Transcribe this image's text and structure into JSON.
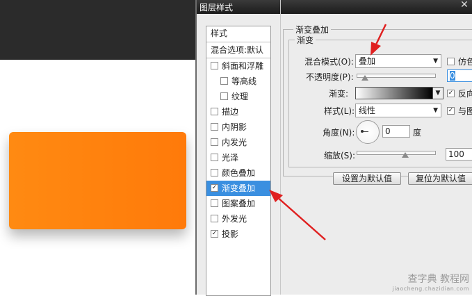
{
  "canvas": {
    "shape_color": "#ff8210"
  },
  "dialog": {
    "title": "图层样式",
    "close_icon": "close-icon",
    "style_list": {
      "header": "样式",
      "blend_options": "混合选项:默认",
      "items": [
        {
          "label": "斜面和浮雕",
          "checked": false,
          "indent": false
        },
        {
          "label": "等高线",
          "checked": false,
          "indent": true
        },
        {
          "label": "纹理",
          "checked": false,
          "indent": true
        },
        {
          "label": "描边",
          "checked": false,
          "indent": false
        },
        {
          "label": "内阴影",
          "checked": false,
          "indent": false
        },
        {
          "label": "内发光",
          "checked": false,
          "indent": false
        },
        {
          "label": "光泽",
          "checked": false,
          "indent": false
        },
        {
          "label": "颜色叠加",
          "checked": false,
          "indent": false
        },
        {
          "label": "渐变叠加",
          "checked": true,
          "indent": false,
          "selected": true
        },
        {
          "label": "图案叠加",
          "checked": false,
          "indent": false
        },
        {
          "label": "外发光",
          "checked": false,
          "indent": false
        },
        {
          "label": "投影",
          "checked": true,
          "indent": false
        }
      ]
    },
    "panel": {
      "title": "渐变叠加",
      "group": "渐变",
      "blend_mode_label": "混合模式(O):",
      "blend_mode_value": "叠加",
      "dither_label": "仿色",
      "opacity_label": "不透明度(P):",
      "opacity_value": "0",
      "gradient_label": "渐变:",
      "reverse_label": "反向",
      "style_label": "样式(L):",
      "style_value": "线性",
      "align_label": "与图",
      "angle_label": "角度(N):",
      "angle_value": "0",
      "angle_unit": "度",
      "scale_label": "缩放(S):",
      "scale_value": "100",
      "btn_default": "设置为默认值",
      "btn_reset": "复位为默认值"
    }
  },
  "watermark": {
    "main": "查字典 教程网",
    "sub": "jiaocheng.chazidian.com"
  }
}
